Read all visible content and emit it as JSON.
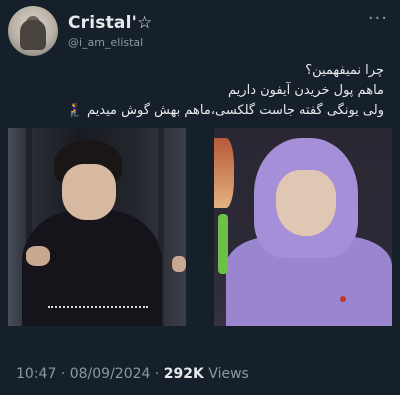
{
  "user": {
    "display_name": "Cristal'☆",
    "handle": "@i_am_elistal"
  },
  "more_icon": "more-dots-icon",
  "tweet": {
    "lines": [
      "چرا نمیفهمین؟",
      "ماهم پول خریدن آیفون داریم",
      "ولی یونگی گفته جاست گلکسی،ماهم بهش گوش میدیم 🧎‍♀️"
    ]
  },
  "media": {
    "count": 2
  },
  "footer": {
    "time": "10:47",
    "separator": " · ",
    "date": "08/09/2024",
    "views_count": "292K",
    "views_label": "Views"
  }
}
